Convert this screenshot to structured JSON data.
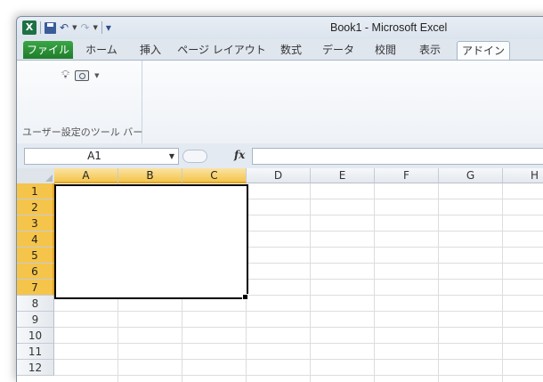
{
  "app": {
    "icon": "excel-icon",
    "title": "Book1 - Microsoft Excel"
  },
  "quick_access": {
    "undo_glyph": "↶",
    "redo_glyph": "↷",
    "customize_glyph": "▾"
  },
  "ribbon_tabs": [
    {
      "label": "ファイル"
    },
    {
      "label": "ホーム"
    },
    {
      "label": "挿入"
    },
    {
      "label": "ページ レイアウト"
    },
    {
      "label": "数式"
    },
    {
      "label": "データ"
    },
    {
      "label": "校閲"
    },
    {
      "label": "表示"
    },
    {
      "label": "アドイン"
    }
  ],
  "active_tab": "アドイン",
  "ribbon_group": {
    "label": "ユーザー設定のツール バー",
    "icons": [
      "lightbulb-icon",
      "camera-icon"
    ]
  },
  "formula_bar": {
    "name_box_value": "A1",
    "fx_label": "fx",
    "formula_value": ""
  },
  "columns": [
    "A",
    "B",
    "C",
    "D",
    "E",
    "F",
    "G",
    "H"
  ],
  "rows": [
    "1",
    "2",
    "3",
    "4",
    "5",
    "6",
    "7",
    "8",
    "9",
    "10",
    "11",
    "12"
  ],
  "selection": {
    "range_start": "A1",
    "range_end": "C7"
  },
  "colors": {
    "file_tab": "#1f7d2a",
    "header_selected": "#f5c44a",
    "selection_border": "#000000"
  }
}
